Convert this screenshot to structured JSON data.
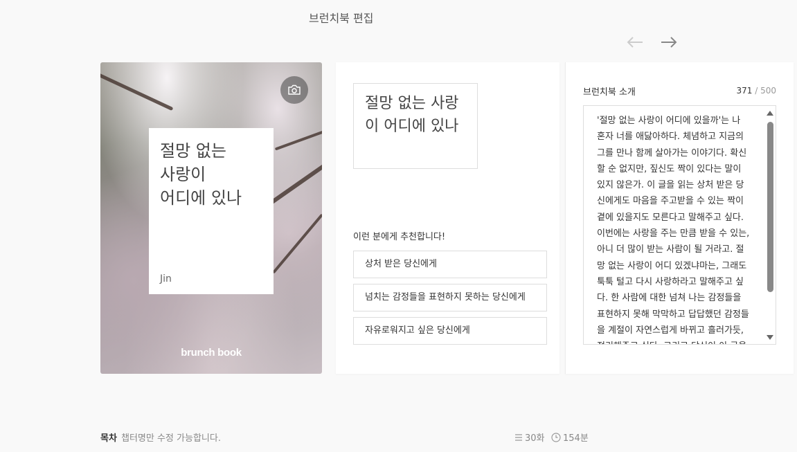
{
  "header": {
    "title": "브런치북 편집"
  },
  "cover": {
    "title": "절망 없는\n사랑이\n어디에 있나",
    "author": "Jin",
    "brand": "brunch book"
  },
  "title_box": {
    "text": "절망 없는 사랑이 어디에 있나"
  },
  "recommend": {
    "label": "이런 분에게 추천합니다!",
    "items": [
      "상처 받은 당신에게",
      "넘치는 감정들을 표현하지 못하는 당신에게",
      "자유로워지고 싶은 당신에게"
    ]
  },
  "intro": {
    "label": "브런치북 소개",
    "count": "371",
    "max": "/ 500",
    "text": "'절망 없는 사랑이 어디에 있을까'는 나 혼자 너를 애닳아하다. 체념하고 지금의 그를 만나 함께 살아가는 이야기다. 확신할 순 없지만, 짚신도 짝이 있다는 말이 있지 않은가. 이 글을 읽는 상처 받은 당신에게도 마음을 주고받을 수 있는 짝이 곁에 있을지도 모른다고 말해주고 싶다. 이번에는 사랑을 주는 만큼 받을 수 있는, 아니 더 많이 받는 사람이 될 거라고. 절망 없는 사랑이 어디 있겠냐마는, 그래도 툭툭 털고 다시 사랑하라고 말해주고 싶다. 한 사람에 대한 넘쳐 나는 감정들을 표현하지 못해 막막하고 답답했던 감정들을 계절이 자연스럽게 바뀌고 흘러가듯, 정리해주고 싶다. 그리고 당신이 이 글을"
  },
  "toc": {
    "label": "목차",
    "hint": "챕터명만 수정 가능합니다.",
    "episodes": "30화",
    "minutes": "154분"
  },
  "icons": {
    "prev": "arrow-left-icon",
    "next": "arrow-right-icon",
    "camera": "camera-icon",
    "list": "list-icon",
    "clock": "clock-icon"
  }
}
